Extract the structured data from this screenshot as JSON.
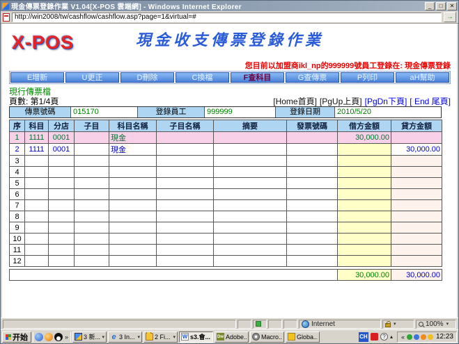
{
  "window": {
    "title": "現金傳票登錄作業 V1.04[X-POS 雲端網] - Windows Internet Explorer",
    "url": "http://win2008/tw/cashflow/cashflow.asp?page=1&virtual=#"
  },
  "header": {
    "logo": "X-POS",
    "title": "現金收支傳票登錄作業",
    "login_status": "您目前以加盟商ikl_np的999999號員工登錄在: 現金傳票登錄"
  },
  "menu": {
    "buttons": [
      {
        "label": "E增新",
        "active": false
      },
      {
        "label": "U更正",
        "active": false
      },
      {
        "label": "D刪除",
        "active": false
      },
      {
        "label": "C換檔",
        "active": false
      },
      {
        "label": "F查科目",
        "active": true
      },
      {
        "label": "G查傳票",
        "active": false
      },
      {
        "label": "P列印",
        "active": false
      },
      {
        "label": "aH幫助",
        "active": false
      }
    ]
  },
  "info": {
    "file_label": "現行傳票檔",
    "page_label": "頁數: 第1/4頁",
    "nav": [
      {
        "label": "[Home首頁]",
        "blue": false
      },
      {
        "label": "[PgUp上頁]",
        "blue": false
      },
      {
        "label": "[PgDn下頁]",
        "blue": true
      },
      {
        "label": "[ End 尾頁]",
        "blue": true
      }
    ]
  },
  "form": {
    "voucher_no_label": "傳票號碼",
    "voucher_no": "015170",
    "employee_label": "登錄員工",
    "employee": "999999",
    "date_label": "登錄日期",
    "date": "2010/5/20"
  },
  "table": {
    "headers": [
      "序",
      "科目",
      "分店",
      "子目",
      "科目名稱",
      "子目名稱",
      "摘要",
      "發票號碼",
      "借方金額",
      "貸方金額"
    ],
    "rows": [
      {
        "seq": "1",
        "subject": "1111",
        "branch": "0001",
        "sub": "",
        "subject_name": "現金",
        "sub_name": "",
        "memo": "",
        "invoice": "",
        "debit": "30,000.00",
        "credit": ""
      },
      {
        "seq": "2",
        "subject": "1111",
        "branch": "0001",
        "sub": "",
        "subject_name": "現金",
        "sub_name": "",
        "memo": "",
        "invoice": "",
        "debit": "",
        "credit": "30,000.00"
      },
      {
        "seq": "3",
        "subject": "",
        "branch": "",
        "sub": "",
        "subject_name": "",
        "sub_name": "",
        "memo": "",
        "invoice": "",
        "debit": "",
        "credit": ""
      },
      {
        "seq": "4",
        "subject": "",
        "branch": "",
        "sub": "",
        "subject_name": "",
        "sub_name": "",
        "memo": "",
        "invoice": "",
        "debit": "",
        "credit": ""
      },
      {
        "seq": "5",
        "subject": "",
        "branch": "",
        "sub": "",
        "subject_name": "",
        "sub_name": "",
        "memo": "",
        "invoice": "",
        "debit": "",
        "credit": ""
      },
      {
        "seq": "6",
        "subject": "",
        "branch": "",
        "sub": "",
        "subject_name": "",
        "sub_name": "",
        "memo": "",
        "invoice": "",
        "debit": "",
        "credit": ""
      },
      {
        "seq": "7",
        "subject": "",
        "branch": "",
        "sub": "",
        "subject_name": "",
        "sub_name": "",
        "memo": "",
        "invoice": "",
        "debit": "",
        "credit": ""
      },
      {
        "seq": "8",
        "subject": "",
        "branch": "",
        "sub": "",
        "subject_name": "",
        "sub_name": "",
        "memo": "",
        "invoice": "",
        "debit": "",
        "credit": ""
      },
      {
        "seq": "9",
        "subject": "",
        "branch": "",
        "sub": "",
        "subject_name": "",
        "sub_name": "",
        "memo": "",
        "invoice": "",
        "debit": "",
        "credit": ""
      },
      {
        "seq": "10",
        "subject": "",
        "branch": "",
        "sub": "",
        "subject_name": "",
        "sub_name": "",
        "memo": "",
        "invoice": "",
        "debit": "",
        "credit": ""
      },
      {
        "seq": "11",
        "subject": "",
        "branch": "",
        "sub": "",
        "subject_name": "",
        "sub_name": "",
        "memo": "",
        "invoice": "",
        "debit": "",
        "credit": ""
      },
      {
        "seq": "12",
        "subject": "",
        "branch": "",
        "sub": "",
        "subject_name": "",
        "sub_name": "",
        "memo": "",
        "invoice": "",
        "debit": "",
        "credit": ""
      }
    ],
    "totals": {
      "debit": "30,000.00",
      "credit": "30,000.00"
    }
  },
  "statusbar": {
    "zone_label": "Internet",
    "zoom_label": "100%"
  },
  "taskbar": {
    "start_label": "开始",
    "buttons": [
      {
        "label": "3 新...",
        "icon": "group-icon",
        "dropdown": true
      },
      {
        "label": "3 In...",
        "icon": "ie-icon",
        "dropdown": true
      },
      {
        "label": "2 Fi...",
        "icon": "folder-icon",
        "dropdown": true
      },
      {
        "label": "s3.會...",
        "icon": "word-icon",
        "pressed": true
      },
      {
        "label": "Adobe...",
        "icon": "dreamweaver-icon"
      },
      {
        "label": "Macro...",
        "icon": "macromedia-icon"
      },
      {
        "label": "Globa...",
        "icon": "globalapp-icon"
      }
    ],
    "tray": {
      "lang": "CH",
      "time": "12:23"
    }
  },
  "colors": {
    "title_blue": "#2b5cd8",
    "logo_red": "#e82222",
    "login_red": "#f00000",
    "button_blue": "#4a80d8",
    "active_button_text": "#6b0040",
    "header_bg": "#aed6f2",
    "selected_row_bg": "#f8d0e8",
    "debit_cell_bg": "#ffffc8",
    "credit_cell_bg": "#fdf3ec",
    "entry1_text": "#007733",
    "entry2_text": "#0000cc",
    "value_green": "#008000"
  }
}
